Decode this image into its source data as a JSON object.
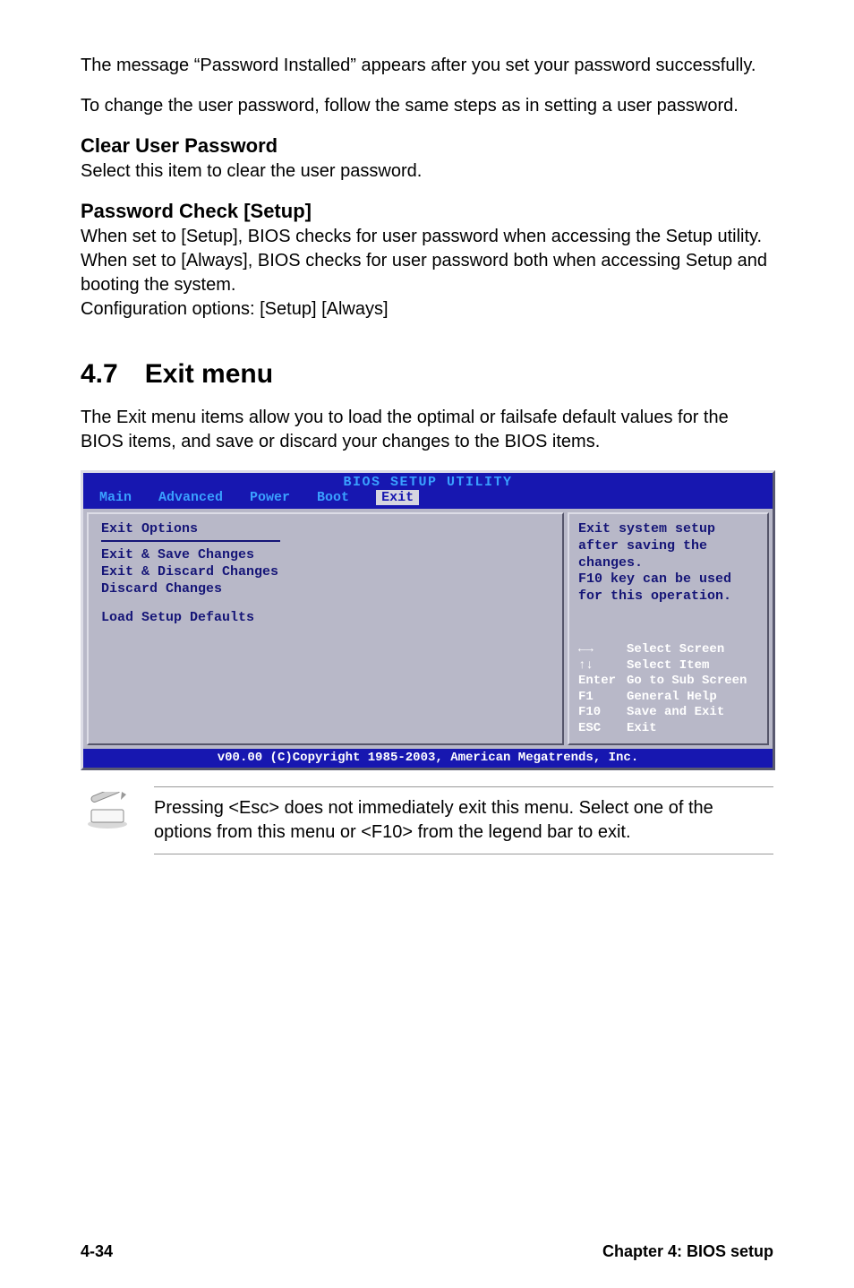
{
  "intro": {
    "p1": "The message “Password Installed” appears after you set your password successfully.",
    "p2": "To change the user password, follow the same steps as in setting a user password."
  },
  "clear_user_password": {
    "heading": "Clear User Password",
    "body": "Select this item to clear the user password."
  },
  "password_check": {
    "heading": "Password Check [Setup]",
    "body1": "When set to [Setup], BIOS checks for user password when accessing the Setup utility. When set to [Always], BIOS checks for user password both when accessing Setup and booting the system.",
    "body2": "Configuration options: [Setup] [Always]"
  },
  "exit_menu": {
    "heading": "4.7 Exit menu",
    "body": "The Exit menu items allow you to load the optimal or failsafe default values for the BIOS items, and save or discard your changes to the BIOS items."
  },
  "bios": {
    "title": "BIOS SETUP UTILITY",
    "tabs": {
      "main": "Main",
      "advanced": "Advanced",
      "power": "Power",
      "boot": "Boot",
      "exit": "Exit"
    },
    "left": {
      "title": "Exit Options",
      "items": [
        "Exit & Save Changes",
        "Exit & Discard Changes",
        "Discard Changes",
        "Load Setup Defaults"
      ]
    },
    "help": "Exit system setup after saving the changes.\nF10 key can be used for this operation.",
    "legend": [
      {
        "key": "←→",
        "label": "Select Screen"
      },
      {
        "key": "↑↓",
        "label": "Select Item"
      },
      {
        "key": "Enter",
        "label": "Go to Sub Screen"
      },
      {
        "key": "F1",
        "label": "General Help"
      },
      {
        "key": "F10",
        "label": "Save and Exit"
      },
      {
        "key": "ESC",
        "label": "Exit"
      }
    ],
    "footer": "v00.00 (C)Copyright 1985-2003, American Megatrends, Inc."
  },
  "note": "Pressing <Esc> does not immediately exit this menu. Select one of the options from this menu or <F10> from the legend bar to exit.",
  "page_footer": {
    "left": "4-34",
    "right": "Chapter 4: BIOS setup"
  }
}
